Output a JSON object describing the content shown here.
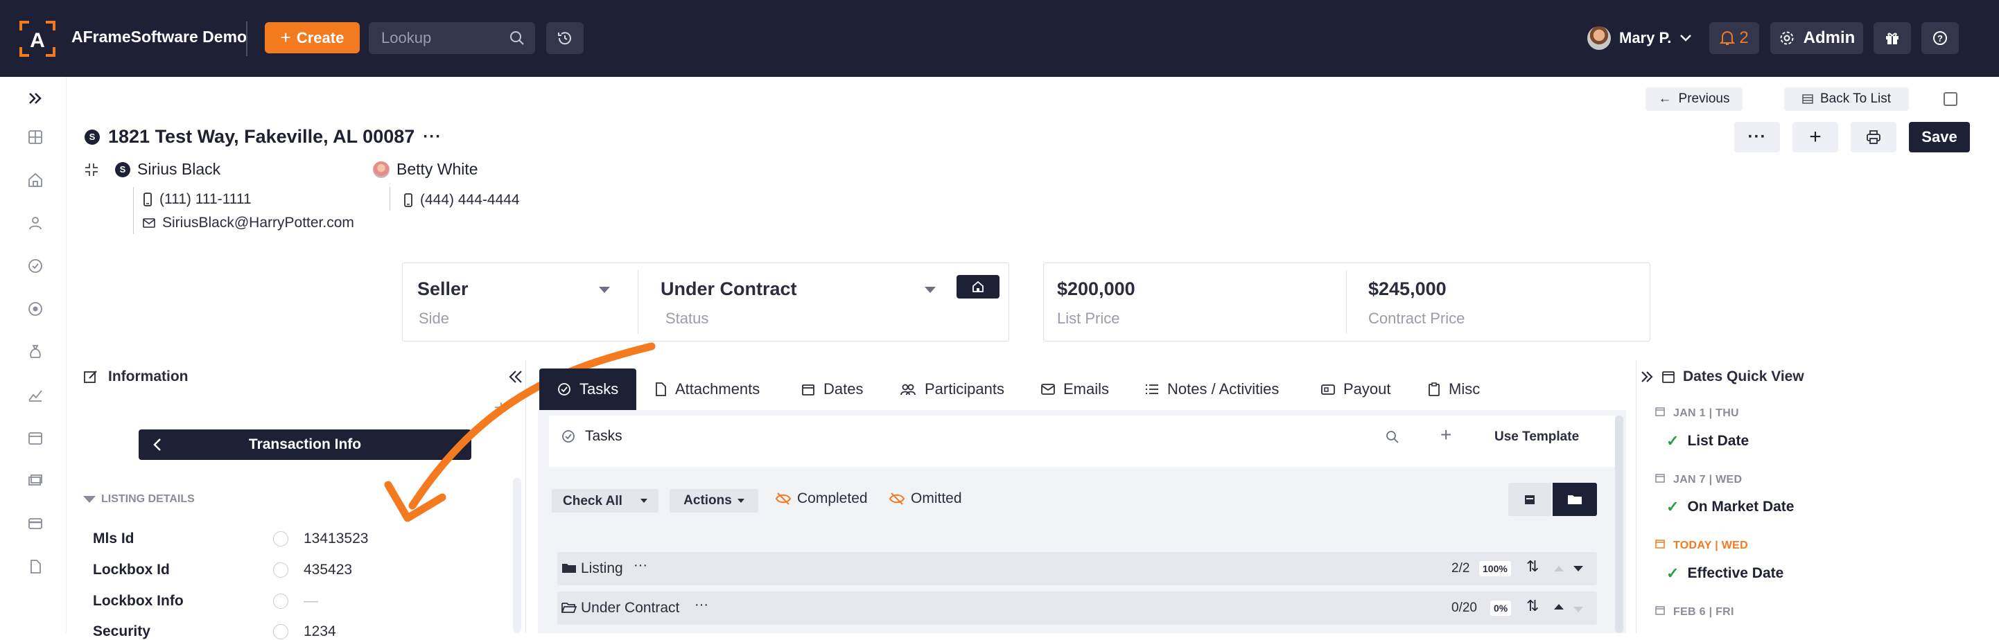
{
  "topbar": {
    "app_title": "AFrameSoftware Demo",
    "create_label": "Create",
    "lookup_placeholder": "Lookup",
    "user_name": "Mary P.",
    "notification_count": "2",
    "admin_label": "Admin"
  },
  "nav": {
    "previous_label": "Previous",
    "back_to_list_label": "Back To List",
    "save_label": "Save"
  },
  "record": {
    "address": "1821 Test Way, Fakeville, AL 00087",
    "agent1": {
      "badge": "S",
      "name": "Sirius Black",
      "phone": "(111) 111-1111",
      "email": "SiriusBlack@HarryPotter.com"
    },
    "agent2": {
      "name": "Betty White",
      "phone": "(444) 444-4444"
    }
  },
  "status": {
    "side_value": "Seller",
    "side_label": "Side",
    "status_value": "Under Contract",
    "status_label": "Status",
    "list_price": "$200,000",
    "list_price_label": "List Price",
    "contract_price": "$245,000",
    "contract_price_label": "Contract Price"
  },
  "info_panel": {
    "title": "Information",
    "transaction_info": "Transaction Info",
    "listing_details": "LISTING DETAILS",
    "fields": [
      {
        "label": "Mls Id",
        "value": "13413523"
      },
      {
        "label": "Lockbox Id",
        "value": "435423"
      },
      {
        "label": "Lockbox Info",
        "value": "—"
      },
      {
        "label": "Security",
        "value": "1234"
      }
    ]
  },
  "tabs": [
    "Tasks",
    "Attachments",
    "Dates",
    "Participants",
    "Emails",
    "Notes / Activities",
    "Payout",
    "Misc"
  ],
  "tasks": {
    "header": "Tasks",
    "use_template": "Use Template",
    "check_all": "Check All",
    "actions": "Actions",
    "completed": "Completed",
    "omitted": "Omitted",
    "rows": [
      {
        "name": "Listing",
        "count": "2/2",
        "percent": "100%"
      },
      {
        "name": "Under Contract",
        "count": "0/20",
        "percent": "0%"
      }
    ]
  },
  "dates_quick_view": {
    "title": "Dates Quick View",
    "items": [
      {
        "date": "JAN 1 | THU",
        "name": "List Date",
        "today": false
      },
      {
        "date": "JAN 7 | WED",
        "name": "On Market Date",
        "today": false
      },
      {
        "date": "TODAY | WED",
        "name": "Effective Date",
        "today": true
      },
      {
        "date": "FEB 6 | FRI",
        "name": "",
        "today": false
      }
    ]
  },
  "colors": {
    "topbar_bg": "#1e2136",
    "accent_orange": "#f47a20",
    "check_green": "#2e9e44"
  }
}
